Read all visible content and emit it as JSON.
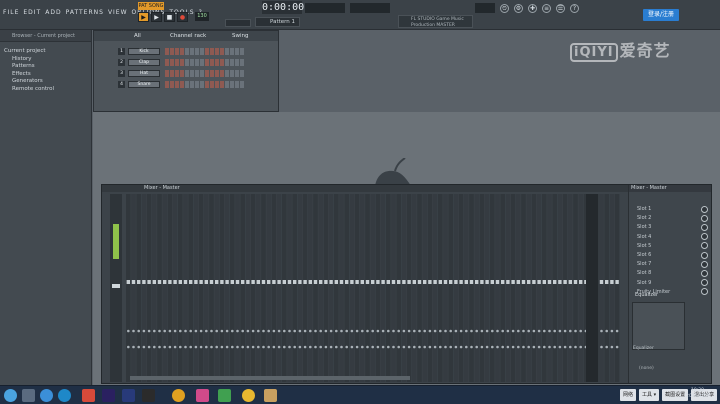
{
  "menu": [
    "FILE",
    "EDIT",
    "ADD",
    "PATTERNS",
    "VIEW",
    "OPTIONS",
    "TOOLS",
    "?"
  ],
  "transport": {
    "pattern_song_label": "PAT SONG",
    "tempo": "130",
    "time_display": "0:00:00",
    "pattern_selector": "Pattern 1",
    "snap_label": "Line"
  },
  "hint_panel": {
    "line1": "FL STUDIO   Game Music",
    "line2": "Production   MASTER"
  },
  "login_button": "登录/注册",
  "watermark": {
    "box": "iQIYI",
    "text": "爱奇艺"
  },
  "browser": {
    "header": "Browser - Current project",
    "items": [
      "Current project",
      "History",
      "Patterns",
      "Effects",
      "Generators",
      "Remote control"
    ]
  },
  "channel_rack": {
    "title": "Channel rack",
    "filter": "All",
    "swing_label": "Swing",
    "channels": [
      {
        "number": "1",
        "name": "Kick"
      },
      {
        "number": "2",
        "name": "Clap"
      },
      {
        "number": "3",
        "name": "Hat"
      },
      {
        "number": "4",
        "name": "Snare"
      }
    ]
  },
  "mixer": {
    "title": "Mixer - Master",
    "strip_label": "Master",
    "insert_title": "Mixer - Master",
    "slots": [
      "Slot 1",
      "Slot 2",
      "Slot 3",
      "Slot 4",
      "Slot 5",
      "Slot 6",
      "Slot 7",
      "Slot 8",
      "Slot 9",
      "Fruity Limiter"
    ],
    "eq_label": "Equalizer",
    "eq_sublabel": "Equalizer",
    "none_label": "(none)"
  },
  "taskbar": {
    "tray_buttons": [
      "网络",
      "工具 ▾",
      "截图设置",
      "退出分享"
    ],
    "clock_time": "10:30",
    "clock_date": "2018/2/27"
  }
}
